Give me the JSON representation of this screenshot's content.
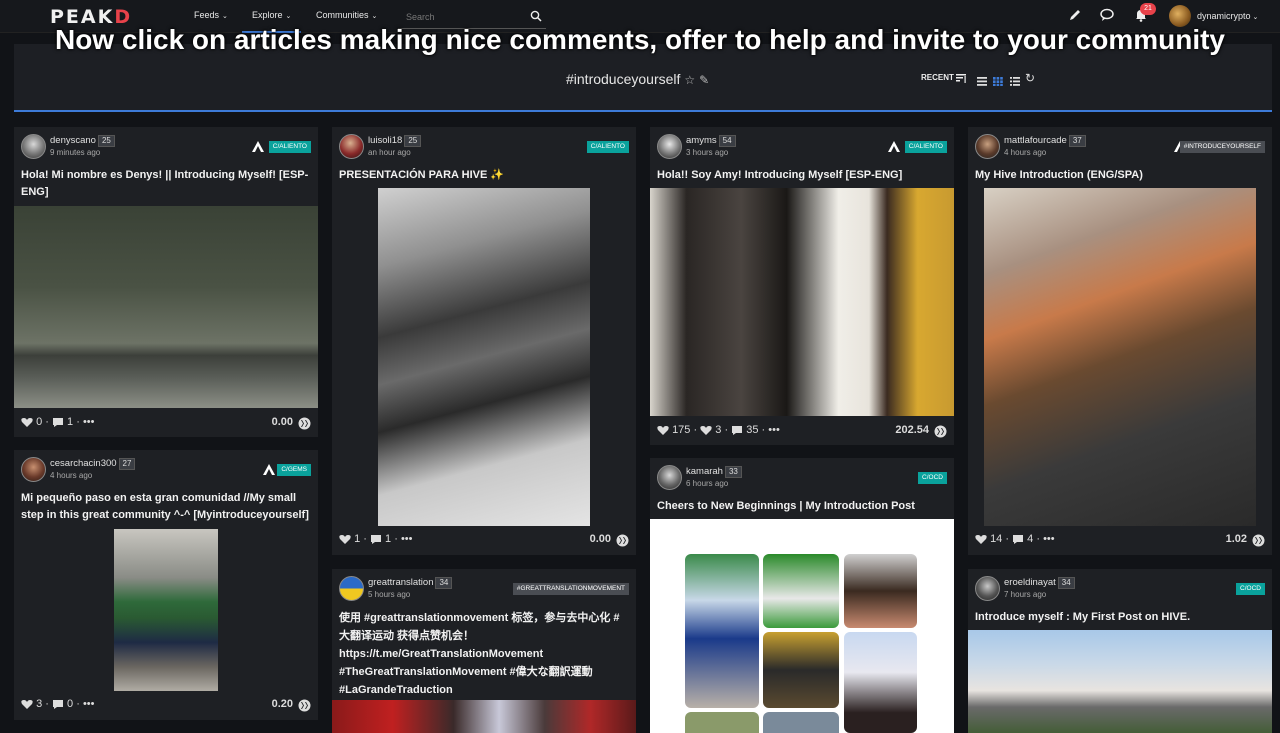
{
  "nav": {
    "logo_main": "PEAK",
    "logo_accent": "D",
    "feeds": "Feeds",
    "explore": "Explore",
    "communities": "Communities",
    "search_placeholder": "Search",
    "notification_count": "21",
    "username": "dynamicrypto"
  },
  "caption": "Now click on articles making nice comments, offer to help and invite to your community",
  "header": {
    "tag": "#introduceyourself",
    "sort_label": "RECENT"
  },
  "cards": [
    {
      "author": "denyscano",
      "rep": "25",
      "time": "9 minutes ago",
      "community": "C/ALIENTO",
      "title": "Hola! Mi nombre es Denys! || Introducing Myself! [ESP-ENG]",
      "likes": "0",
      "comments": "1",
      "reblogs": "",
      "payout": "0.00"
    },
    {
      "author": "cesarchacin300",
      "rep": "27",
      "time": "4 hours ago",
      "community": "C/GEMS",
      "title": "Mi pequeño paso en esta gran comunidad //My small step in this great community ^-^ [Myintroduceyourself]",
      "likes": "3",
      "comments": "0",
      "reblogs": "",
      "payout": "0.20"
    },
    {
      "author": "luisoli18",
      "rep": "25",
      "time": "an hour ago",
      "community": "C/ALIENTO",
      "title": "PRESENTACIÓN PARA HIVE ✨",
      "likes": "1",
      "comments": "1",
      "reblogs": "",
      "payout": "0.00"
    },
    {
      "author": "greattranslation",
      "rep": "34",
      "time": "5 hours ago",
      "community": "#GREATTRANSLATIONMOVEMENT",
      "title": "使用 #greattranslationmovement 标签，参与去中心化 #大翻译运动 获得点赞机会！ https://t.me/GreatTranslationMovement #TheGreatTranslationMovement #偉大な翻訳運動 #LaGrandeTraduction",
      "likes": "",
      "comments": "",
      "reblogs": "",
      "payout": ""
    },
    {
      "author": "amyms",
      "rep": "54",
      "time": "3 hours ago",
      "community": "C/ALIENTO",
      "title": "Hola!! Soy Amy! Introducing Myself [ESP-ENG]",
      "likes": "175",
      "comments": "35",
      "reblogs": "3",
      "payout": "202.54"
    },
    {
      "author": "kamarah",
      "rep": "33",
      "time": "6 hours ago",
      "community": "C/OCD",
      "title": "Cheers to New Beginnings | My Introduction Post",
      "likes": "",
      "comments": "",
      "reblogs": "",
      "payout": ""
    },
    {
      "author": "mattlafourcade",
      "rep": "37",
      "time": "4 hours ago",
      "community": "#INTRODUCEYOURSELF",
      "title": "My Hive Introduction (ENG/SPA)",
      "likes": "14",
      "comments": "4",
      "reblogs": "",
      "payout": "1.02"
    },
    {
      "author": "eroeldinayat",
      "rep": "34",
      "time": "7 hours ago",
      "community": "C/OCD",
      "title": "Introduce myself : My First Post on HIVE.",
      "likes": "",
      "comments": "",
      "reblogs": "",
      "payout": ""
    }
  ],
  "colors": {
    "accent": "#3d7bd8",
    "community_badge": "#0aa29c",
    "brand_red": "#e8424a"
  }
}
